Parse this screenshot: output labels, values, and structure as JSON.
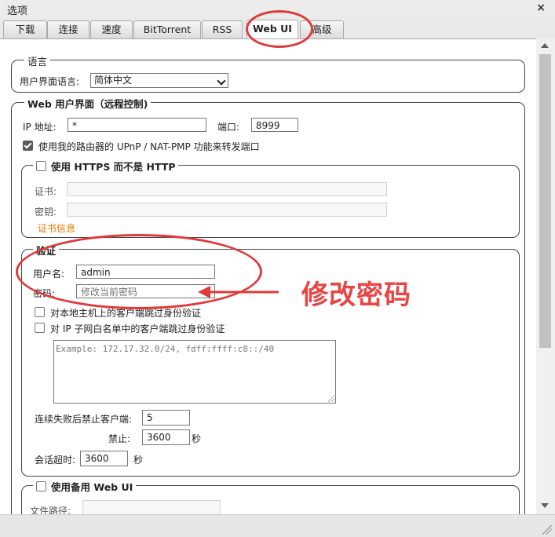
{
  "window": {
    "title": "选项",
    "close_glyph": "×"
  },
  "tabs": [
    {
      "label": "下载"
    },
    {
      "label": "连接"
    },
    {
      "label": "速度"
    },
    {
      "label": "BitTorrent"
    },
    {
      "label": "RSS"
    },
    {
      "label": "Web UI",
      "active": true
    },
    {
      "label": "高级"
    }
  ],
  "language": {
    "legend": "语言",
    "label": "用户界面语言:",
    "selected": "简体中文"
  },
  "webui": {
    "legend": "Web 用户界面（远程控制)",
    "ip_label": "IP 地址:",
    "ip_value": "*",
    "port_label": "端口:",
    "port_value": "8999",
    "upnp_label": "使用我的路由器的 UPnP / NAT-PMP 功能来转发端口",
    "upnp_checked": true
  },
  "https": {
    "legend": "使用 HTTPS 而不是 HTTP",
    "cert_label": "证书:",
    "key_label": "密钥:",
    "cert_info_link": "证书信息"
  },
  "auth": {
    "legend": "验证",
    "username_label": "用户名:",
    "username_value": "admin",
    "password_label": "密码:",
    "password_placeholder": "修改当前密码",
    "bypass_local_label": "对本地主机上的客户端跳过身份验证",
    "bypass_whitelist_label": "对 IP 子网白名单中的客户端跳过身份验证",
    "whitelist_placeholder": "Example: 172.17.32.0/24, fdff:ffff:c8::/40",
    "ban_after_label": "连续失败后禁止客户端:",
    "ban_after_value": "5",
    "ban_label": "禁止:",
    "ban_value": "3600",
    "ban_unit": "秒",
    "session_timeout_label": "会话超时:",
    "session_timeout_value": "3600",
    "session_timeout_unit": "秒"
  },
  "alt_webui": {
    "legend": "使用备用 Web UI",
    "path_label": "文件路径:"
  },
  "annotation": {
    "text": "修改密码",
    "color": "#e84545"
  },
  "colors": {
    "link": "#e07b00",
    "annotation_red": "#e03a3a"
  }
}
